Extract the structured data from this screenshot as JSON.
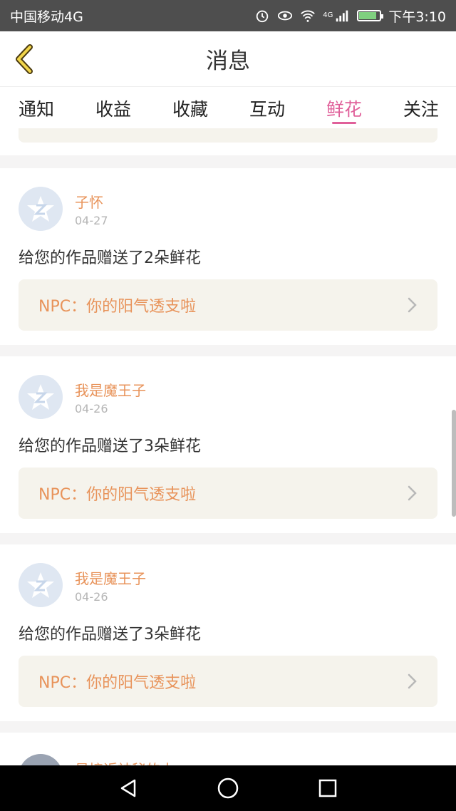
{
  "status_bar": {
    "carrier": "中国移动4G",
    "time": "下午3:10",
    "network_label": "4G"
  },
  "header": {
    "title": "消息"
  },
  "tabs": [
    {
      "label": "通知",
      "active": false
    },
    {
      "label": "收益",
      "active": false
    },
    {
      "label": "收藏",
      "active": false
    },
    {
      "label": "互动",
      "active": false
    },
    {
      "label": "鲜花",
      "active": true
    },
    {
      "label": "关注",
      "active": false
    }
  ],
  "accent_color": "#e0609a",
  "name_color": "#e8935a",
  "messages": [
    {
      "name": "子怀",
      "date": "04-27",
      "text": "给您的作品赠送了2朵鲜花",
      "quote": "NPC：你的阳气透支啦"
    },
    {
      "name": "我是魔王子",
      "date": "04-26",
      "text": "给您的作品赠送了3朵鲜花",
      "quote": "NPC：你的阳气透支啦"
    },
    {
      "name": "我是魔王子",
      "date": "04-26",
      "text": "给您的作品赠送了3朵鲜花",
      "quote": "NPC：你的阳气透支啦"
    }
  ],
  "partial_message": {
    "name": "最接近神秘的人"
  }
}
